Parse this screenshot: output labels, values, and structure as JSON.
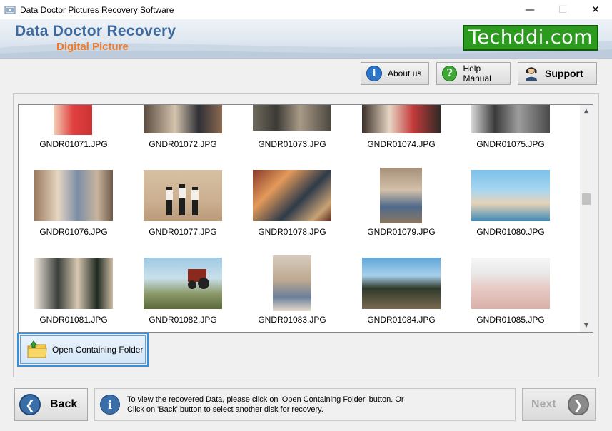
{
  "window": {
    "title": "Data Doctor Pictures Recovery Software",
    "controls": [
      "—",
      "☐",
      "✕"
    ]
  },
  "banner": {
    "title": "Data Doctor Recovery",
    "subtitle": "Digital Picture",
    "logo": "Techddi.com"
  },
  "toolbar": {
    "about_label": "About us",
    "help_label": "Help Manual",
    "support_label": "Support"
  },
  "gallery": {
    "rows": [
      [
        "GNDR01071.JPG",
        "GNDR01072.JPG",
        "GNDR01073.JPG",
        "GNDR01074.JPG",
        "GNDR01075.JPG"
      ],
      [
        "GNDR01076.JPG",
        "GNDR01077.JPG",
        "GNDR01078.JPG",
        "GNDR01079.JPG",
        "GNDR01080.JPG"
      ],
      [
        "GNDR01081.JPG",
        "GNDR01082.JPG",
        "GNDR01083.JPG",
        "GNDR01084.JPG",
        "GNDR01085.JPG"
      ]
    ]
  },
  "open_folder_label": "Open Containing Folder",
  "footer": {
    "back_label": "Back",
    "next_label": "Next",
    "info_line1": "To view the recovered Data, please click on 'Open Containing Folder' button. Or",
    "info_line2": "Click on 'Back' button to select another disk for recovery."
  },
  "colors": {
    "brand_blue": "#3f6a9b",
    "brand_orange": "#ef7b2a",
    "logo_green": "#2c9a1f",
    "selection_blue": "#3b8ed8"
  }
}
